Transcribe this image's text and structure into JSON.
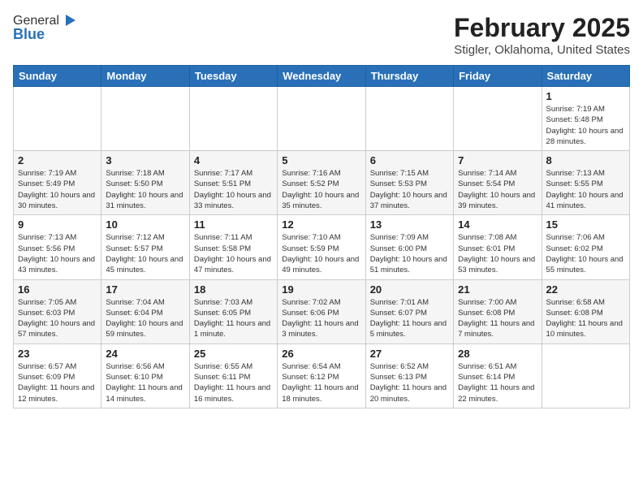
{
  "header": {
    "logo_general": "General",
    "logo_blue": "Blue",
    "title": "February 2025",
    "subtitle": "Stigler, Oklahoma, United States"
  },
  "calendar": {
    "weekdays": [
      "Sunday",
      "Monday",
      "Tuesday",
      "Wednesday",
      "Thursday",
      "Friday",
      "Saturday"
    ],
    "rows": [
      [
        {
          "day": "",
          "info": ""
        },
        {
          "day": "",
          "info": ""
        },
        {
          "day": "",
          "info": ""
        },
        {
          "day": "",
          "info": ""
        },
        {
          "day": "",
          "info": ""
        },
        {
          "day": "",
          "info": ""
        },
        {
          "day": "1",
          "info": "Sunrise: 7:19 AM\nSunset: 5:48 PM\nDaylight: 10 hours and 28 minutes."
        }
      ],
      [
        {
          "day": "2",
          "info": "Sunrise: 7:19 AM\nSunset: 5:49 PM\nDaylight: 10 hours and 30 minutes."
        },
        {
          "day": "3",
          "info": "Sunrise: 7:18 AM\nSunset: 5:50 PM\nDaylight: 10 hours and 31 minutes."
        },
        {
          "day": "4",
          "info": "Sunrise: 7:17 AM\nSunset: 5:51 PM\nDaylight: 10 hours and 33 minutes."
        },
        {
          "day": "5",
          "info": "Sunrise: 7:16 AM\nSunset: 5:52 PM\nDaylight: 10 hours and 35 minutes."
        },
        {
          "day": "6",
          "info": "Sunrise: 7:15 AM\nSunset: 5:53 PM\nDaylight: 10 hours and 37 minutes."
        },
        {
          "day": "7",
          "info": "Sunrise: 7:14 AM\nSunset: 5:54 PM\nDaylight: 10 hours and 39 minutes."
        },
        {
          "day": "8",
          "info": "Sunrise: 7:13 AM\nSunset: 5:55 PM\nDaylight: 10 hours and 41 minutes."
        }
      ],
      [
        {
          "day": "9",
          "info": "Sunrise: 7:13 AM\nSunset: 5:56 PM\nDaylight: 10 hours and 43 minutes."
        },
        {
          "day": "10",
          "info": "Sunrise: 7:12 AM\nSunset: 5:57 PM\nDaylight: 10 hours and 45 minutes."
        },
        {
          "day": "11",
          "info": "Sunrise: 7:11 AM\nSunset: 5:58 PM\nDaylight: 10 hours and 47 minutes."
        },
        {
          "day": "12",
          "info": "Sunrise: 7:10 AM\nSunset: 5:59 PM\nDaylight: 10 hours and 49 minutes."
        },
        {
          "day": "13",
          "info": "Sunrise: 7:09 AM\nSunset: 6:00 PM\nDaylight: 10 hours and 51 minutes."
        },
        {
          "day": "14",
          "info": "Sunrise: 7:08 AM\nSunset: 6:01 PM\nDaylight: 10 hours and 53 minutes."
        },
        {
          "day": "15",
          "info": "Sunrise: 7:06 AM\nSunset: 6:02 PM\nDaylight: 10 hours and 55 minutes."
        }
      ],
      [
        {
          "day": "16",
          "info": "Sunrise: 7:05 AM\nSunset: 6:03 PM\nDaylight: 10 hours and 57 minutes."
        },
        {
          "day": "17",
          "info": "Sunrise: 7:04 AM\nSunset: 6:04 PM\nDaylight: 10 hours and 59 minutes."
        },
        {
          "day": "18",
          "info": "Sunrise: 7:03 AM\nSunset: 6:05 PM\nDaylight: 11 hours and 1 minute."
        },
        {
          "day": "19",
          "info": "Sunrise: 7:02 AM\nSunset: 6:06 PM\nDaylight: 11 hours and 3 minutes."
        },
        {
          "day": "20",
          "info": "Sunrise: 7:01 AM\nSunset: 6:07 PM\nDaylight: 11 hours and 5 minutes."
        },
        {
          "day": "21",
          "info": "Sunrise: 7:00 AM\nSunset: 6:08 PM\nDaylight: 11 hours and 7 minutes."
        },
        {
          "day": "22",
          "info": "Sunrise: 6:58 AM\nSunset: 6:08 PM\nDaylight: 11 hours and 10 minutes."
        }
      ],
      [
        {
          "day": "23",
          "info": "Sunrise: 6:57 AM\nSunset: 6:09 PM\nDaylight: 11 hours and 12 minutes."
        },
        {
          "day": "24",
          "info": "Sunrise: 6:56 AM\nSunset: 6:10 PM\nDaylight: 11 hours and 14 minutes."
        },
        {
          "day": "25",
          "info": "Sunrise: 6:55 AM\nSunset: 6:11 PM\nDaylight: 11 hours and 16 minutes."
        },
        {
          "day": "26",
          "info": "Sunrise: 6:54 AM\nSunset: 6:12 PM\nDaylight: 11 hours and 18 minutes."
        },
        {
          "day": "27",
          "info": "Sunrise: 6:52 AM\nSunset: 6:13 PM\nDaylight: 11 hours and 20 minutes."
        },
        {
          "day": "28",
          "info": "Sunrise: 6:51 AM\nSunset: 6:14 PM\nDaylight: 11 hours and 22 minutes."
        },
        {
          "day": "",
          "info": ""
        }
      ]
    ]
  }
}
